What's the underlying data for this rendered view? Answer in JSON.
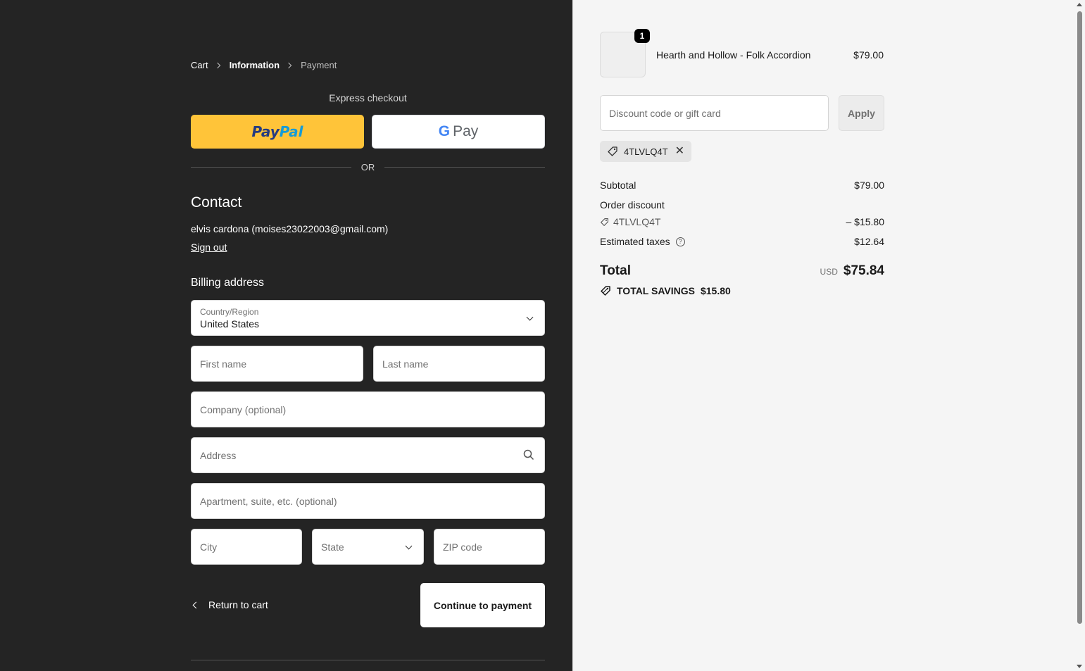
{
  "breadcrumb": {
    "cart": "Cart",
    "information": "Information",
    "payment": "Payment"
  },
  "express": {
    "title": "Express checkout",
    "paypal_a": "Pay",
    "paypal_b": "Pal",
    "gpay_g": "G",
    "gpay_label": "Pay",
    "or": "OR"
  },
  "contact": {
    "title": "Contact",
    "info": "elvis cardona (moises23022003@gmail.com)",
    "sign_out": "Sign out"
  },
  "billing": {
    "title": "Billing address",
    "country_label": "Country/Region",
    "country_value": "United States",
    "first_name_placeholder": "First name",
    "last_name_placeholder": "Last name",
    "company_placeholder": "Company (optional)",
    "address_placeholder": "Address",
    "apartment_placeholder": "Apartment, suite, etc. (optional)",
    "city_placeholder": "City",
    "state_placeholder": "State",
    "zip_placeholder": "ZIP code"
  },
  "actions": {
    "return_to_cart": "Return to cart",
    "continue": "Continue to payment"
  },
  "summary": {
    "product": {
      "name": "Hearth and Hollow - Folk Accordion",
      "price": "$79.00",
      "quantity": "1"
    },
    "discount_placeholder": "Discount code or gift card",
    "apply": "Apply",
    "applied_code": "4TLVLQ4T",
    "subtotal_label": "Subtotal",
    "subtotal_value": "$79.00",
    "order_discount_label": "Order discount",
    "discount_code": "4TLVLQ4T",
    "discount_value": "– $15.80",
    "taxes_label": "Estimated taxes",
    "taxes_value": "$12.64",
    "help_glyph": "?",
    "total_label": "Total",
    "currency": "USD",
    "total_value": "$75.84",
    "savings_label": "TOTAL SAVINGS",
    "savings_value": "$15.80"
  },
  "colors": {
    "left_bg": "#242424",
    "right_bg": "#f5f5f5",
    "paypal": "#ffc439"
  }
}
